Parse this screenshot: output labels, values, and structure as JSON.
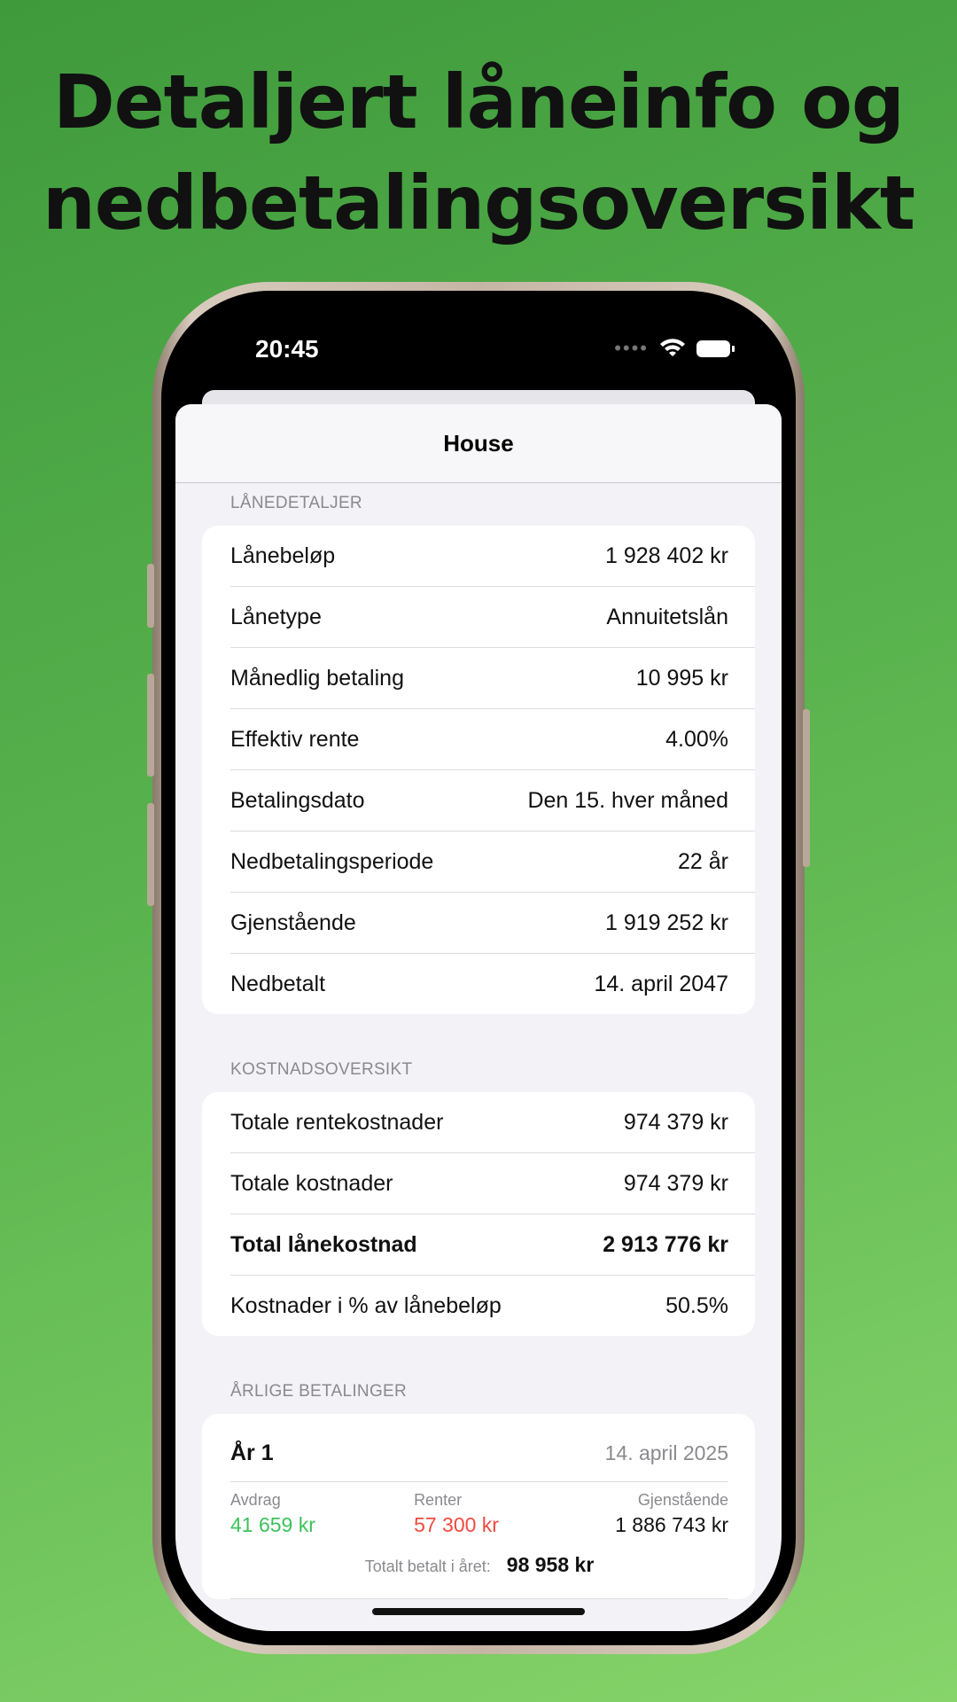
{
  "headline": {
    "line1": "Detaljert låneinfo og",
    "line2": "nedbetalingsoversikt"
  },
  "status_bar": {
    "time": "20:45",
    "icons": [
      "cellular-dots-icon",
      "wifi-icon",
      "battery-icon"
    ]
  },
  "nav": {
    "title": "House"
  },
  "loan_details": {
    "header": "LÅNEDETALJER",
    "rows": [
      {
        "label": "Lånebeløp",
        "value": "1 928 402 kr"
      },
      {
        "label": "Lånetype",
        "value": "Annuitetslån"
      },
      {
        "label": "Månedlig betaling",
        "value": "10 995 kr"
      },
      {
        "label": "Effektiv rente",
        "value": "4.00%"
      },
      {
        "label": "Betalingsdato",
        "value": "Den 15. hver måned"
      },
      {
        "label": "Nedbetalingsperiode",
        "value": "22 år"
      },
      {
        "label": "Gjenstående",
        "value": "1 919 252 kr"
      },
      {
        "label": "Nedbetalt",
        "value": "14. april 2047"
      }
    ]
  },
  "cost_overview": {
    "header": "KOSTNADSOVERSIKT",
    "rows": [
      {
        "label": "Totale rentekostnader",
        "value": "974 379 kr"
      },
      {
        "label": "Totale kostnader",
        "value": "974 379 kr"
      },
      {
        "label": "Total lånekostnad",
        "value": "2 913 776 kr"
      },
      {
        "label": "Kostnader i % av lånebeløp",
        "value": "50.5%"
      }
    ]
  },
  "yearly_payments": {
    "header": "ÅRLIGE BETALINGER",
    "years": [
      {
        "title": "År 1",
        "date": "14. april 2025",
        "avdrag_label": "Avdrag",
        "avdrag_value": "41 659 kr",
        "renter_label": "Renter",
        "renter_value": "57 300 kr",
        "gjenstaende_label": "Gjenstående",
        "gjenstaende_value": "1 886 743 kr",
        "total_label": "Totalt betalt i året:",
        "total_value": "98 958 kr"
      }
    ]
  },
  "colors": {
    "background_top": "#3f9a3c",
    "background_bottom": "#86d46a",
    "positive": "#3cc25a",
    "negative": "#f04a3f"
  }
}
